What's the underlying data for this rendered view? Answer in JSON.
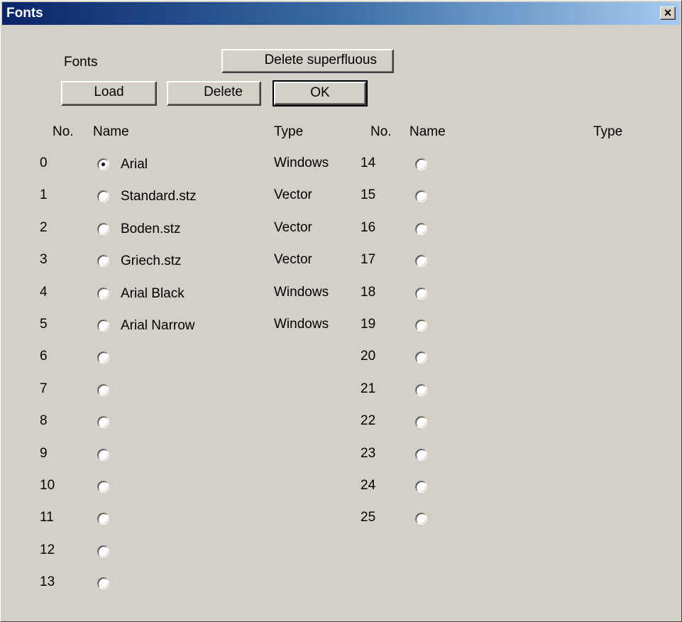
{
  "window": {
    "title": "Fonts",
    "close_label": "×"
  },
  "toolbar": {
    "fonts_label": "Fonts",
    "delete_superfluous_label": "Delete superfluous",
    "load_label": "Load",
    "delete_label": "Delete",
    "ok_label": "OK"
  },
  "headers": {
    "no": "No.",
    "name": "Name",
    "type": "Type"
  },
  "fonts_left": [
    {
      "no": "0",
      "name": "Arial",
      "type": "Windows",
      "selected": true
    },
    {
      "no": "1",
      "name": "Standard.stz",
      "type": "Vector"
    },
    {
      "no": "2",
      "name": "Boden.stz",
      "type": "Vector"
    },
    {
      "no": "3",
      "name": "Griech.stz",
      "type": "Vector"
    },
    {
      "no": "4",
      "name": "Arial Black",
      "type": "Windows"
    },
    {
      "no": "5",
      "name": "Arial Narrow",
      "type": "Windows"
    },
    {
      "no": "6",
      "name": "",
      "type": ""
    },
    {
      "no": "7",
      "name": "",
      "type": ""
    },
    {
      "no": "8",
      "name": "",
      "type": ""
    },
    {
      "no": "9",
      "name": "",
      "type": ""
    },
    {
      "no": "10",
      "name": "",
      "type": ""
    },
    {
      "no": "11",
      "name": "",
      "type": ""
    },
    {
      "no": "12",
      "name": "",
      "type": ""
    },
    {
      "no": "13",
      "name": "",
      "type": ""
    }
  ],
  "fonts_right": [
    {
      "no": "14",
      "name": "",
      "type": ""
    },
    {
      "no": "15",
      "name": "",
      "type": ""
    },
    {
      "no": "16",
      "name": "",
      "type": ""
    },
    {
      "no": "17",
      "name": "",
      "type": ""
    },
    {
      "no": "18",
      "name": "",
      "type": ""
    },
    {
      "no": "19",
      "name": "",
      "type": ""
    },
    {
      "no": "20",
      "name": "",
      "type": ""
    },
    {
      "no": "21",
      "name": "",
      "type": ""
    },
    {
      "no": "22",
      "name": "",
      "type": ""
    },
    {
      "no": "23",
      "name": "",
      "type": ""
    },
    {
      "no": "24",
      "name": "",
      "type": ""
    },
    {
      "no": "25",
      "name": "",
      "type": ""
    }
  ]
}
